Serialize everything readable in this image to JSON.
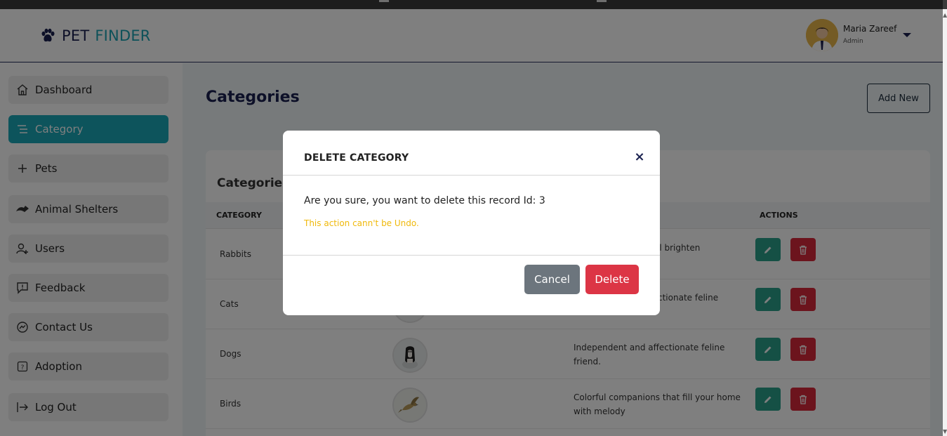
{
  "app": {
    "logo_word1": "PET",
    "logo_word2": "FINDER"
  },
  "user": {
    "name": "Maria Zareef",
    "role": "Admin"
  },
  "sidebar": {
    "items": [
      {
        "label": "Dashboard",
        "icon": "home-icon",
        "active": false
      },
      {
        "label": "Category",
        "icon": "list-icon",
        "active": true
      },
      {
        "label": "Pets",
        "icon": "plus-icon",
        "active": false
      },
      {
        "label": "Animal Shelters",
        "icon": "shelter-icon",
        "active": false
      },
      {
        "label": "Users",
        "icon": "user-add-icon",
        "active": false
      },
      {
        "label": "Feedback",
        "icon": "feedback-icon",
        "active": false
      },
      {
        "label": "Contact Us",
        "icon": "messenger-icon",
        "active": false
      },
      {
        "label": "Adoption",
        "icon": "question-icon",
        "active": false
      },
      {
        "label": "Log Out",
        "icon": "logout-icon",
        "active": false
      }
    ]
  },
  "main": {
    "title": "Categories",
    "add_new_label": "Add New",
    "card_title": "Categories",
    "columns": {
      "category": "CATEGORY",
      "actions": "ACTIONS"
    },
    "rows": [
      {
        "name": "Rabbits",
        "description": "at will brighten"
      },
      {
        "name": "Cats",
        "description": "ctionate feline"
      },
      {
        "name": "Dogs",
        "description": "Independent and affectionate feline friend."
      },
      {
        "name": "Birds",
        "description": "Colorful companions that fill your home with melody"
      }
    ]
  },
  "modal": {
    "title": "DELETE CATEGORY",
    "close_symbol": "×",
    "message": "Are you sure, you want to delete this record Id: 3",
    "warning": "This action cann't be Undo.",
    "cancel_label": "Cancel",
    "delete_label": "Delete"
  },
  "colors": {
    "accent": "#1aa8b8",
    "brand_dark": "#1b2150",
    "edit": "#2aa08a",
    "danger": "#dc3545",
    "secondary": "#6c757d",
    "warning": "#f0b90b"
  }
}
